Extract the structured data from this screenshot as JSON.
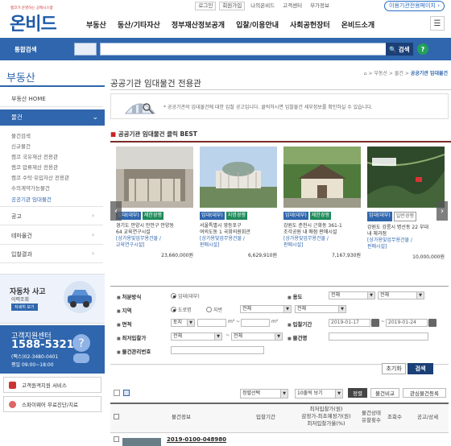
{
  "top_util": {
    "login": "로그인",
    "join": "회원가입",
    "my_onbid": "나의온비드",
    "customer_center": "고객센터",
    "extra_info": "부가정보",
    "exclusive_page": "이용기관전용페이지"
  },
  "logo": {
    "sub": "캠코가 운영하는 공매시스템",
    "main": "온비드"
  },
  "gnb": [
    "부동산",
    "동산/기타자산",
    "정부재산정보공개",
    "입찰/이용안내",
    "사회공헌장터",
    "온비드소개"
  ],
  "search": {
    "label": "통합검색",
    "button": "검색",
    "help": "?",
    "placeholder": ""
  },
  "sidebar": {
    "title": "부동산",
    "home": "부동산 HOME",
    "active": "물건",
    "sub_items": [
      "물건검색",
      "신규물건",
      "캠코 국유재산 전용관",
      "캠코 압류재산 전용관",
      "캠코 수탁·유입자산 전용관",
      "수의계약가능물건",
      "공공기관 임대물건"
    ],
    "items": [
      "공고",
      "테마물건",
      "입찰결과"
    ]
  },
  "car_banner": {
    "title": "자동차 사고",
    "subtitle": "이력조회",
    "button": "자세히 보기"
  },
  "customer_center": {
    "title": "고객지원센터",
    "phone": "1588-5321",
    "fax": "(팩스)02-3480-0401",
    "hours": "평일 09:00~18:00"
  },
  "side_buttons": [
    "고객원격지원 서비스",
    "스파이웨어 무료진단/치료"
  ],
  "main": {
    "title": "공공기관 임대물건 전용관",
    "breadcrumb": [
      "부동산",
      "물건",
      "공공기관 임대물건"
    ],
    "notice": "공공기관의 임대물건에 대한 입찰 공고입니다. 클릭하시면 입찰물건 세부정보를 확인하실 수 있습니다.",
    "best_title": "공공기관 임대물건 클릭 BEST"
  },
  "cards": [
    {
      "badge1": "임대(대부)",
      "badge2": "제한경쟁",
      "line1": "경기도 안양시 만안구 안양동",
      "line2": "64 교육연구시설",
      "cat": "[상가용및업무용건물 /",
      "cat2": "교육연구시설]",
      "price": "23,660,000원"
    },
    {
      "badge1": "임대(대부)",
      "badge2": "지명경쟁",
      "line1": "서울특별시 영등포구",
      "line2": "여의도동 1 국회의원회관",
      "cat": "[상가용및업무용건물 /",
      "cat2": "판매시설]",
      "price": "6,629,910원"
    },
    {
      "badge1": "임대(대부)",
      "badge2": "제한경쟁",
      "line1": "강원도 춘천시 근화동 361-1",
      "line2": "조각공원 내 매점 판매시설",
      "cat": "[상가용및업무용건물 /",
      "cat2": "판매시설]",
      "price": "7,167,930원"
    },
    {
      "badge1": "임대(대부)",
      "badge2": "일반경쟁",
      "line1": "강원도 강릉시 병산동 22 부대",
      "line2": "내 체과점",
      "cat": "[상가용및업무용건물 /",
      "cat2": "판매시설]",
      "price": "10,000,000원"
    }
  ],
  "form": {
    "disposal_label": "처분방식",
    "disposal_value": "임대(대부)",
    "usage_label": "용도",
    "usage_v1": "전체",
    "usage_v2": "전체",
    "region_label": "지역",
    "region_r1": "도로명",
    "region_r2": "지번",
    "region_v1": "전체",
    "region_v2": "전체",
    "area_label": "면적",
    "area_v1": "토지",
    "area_unit": "m²",
    "area_tilde": "~",
    "bid_period_label": "입찰기간",
    "bid_from": "2019-01-17",
    "bid_tilde": "~",
    "bid_to": "2019-01-24",
    "min_price_label": "최저입찰가",
    "min_v1": "전체",
    "min_tilde": "~",
    "min_v2": "전체",
    "item_name_label": "물건명",
    "item_no_label": "물건관리번호",
    "reset": "초기화",
    "search": "검색"
  },
  "list_bar": {
    "sort": "정렬선택",
    "per_page": "10줄씩 보기",
    "sort_btn": "정렬",
    "compare": "물건비교",
    "interest": "관심물건등록"
  },
  "table": {
    "headers": [
      "물건정보",
      "입찰기간",
      "최저입찰가(원)",
      "감정가-최초예정가(원)",
      "최저입찰가율(%)",
      "물건상태",
      "유찰횟수",
      "조회수",
      "공고/상세"
    ],
    "first_row_no": "2019-0100-048980"
  },
  "colors": {
    "brand_blue": "#2f66ad",
    "best_line": "#7c2b2b",
    "badge_blue": "#2f66ad",
    "badge_green": "#1f8a5a"
  }
}
